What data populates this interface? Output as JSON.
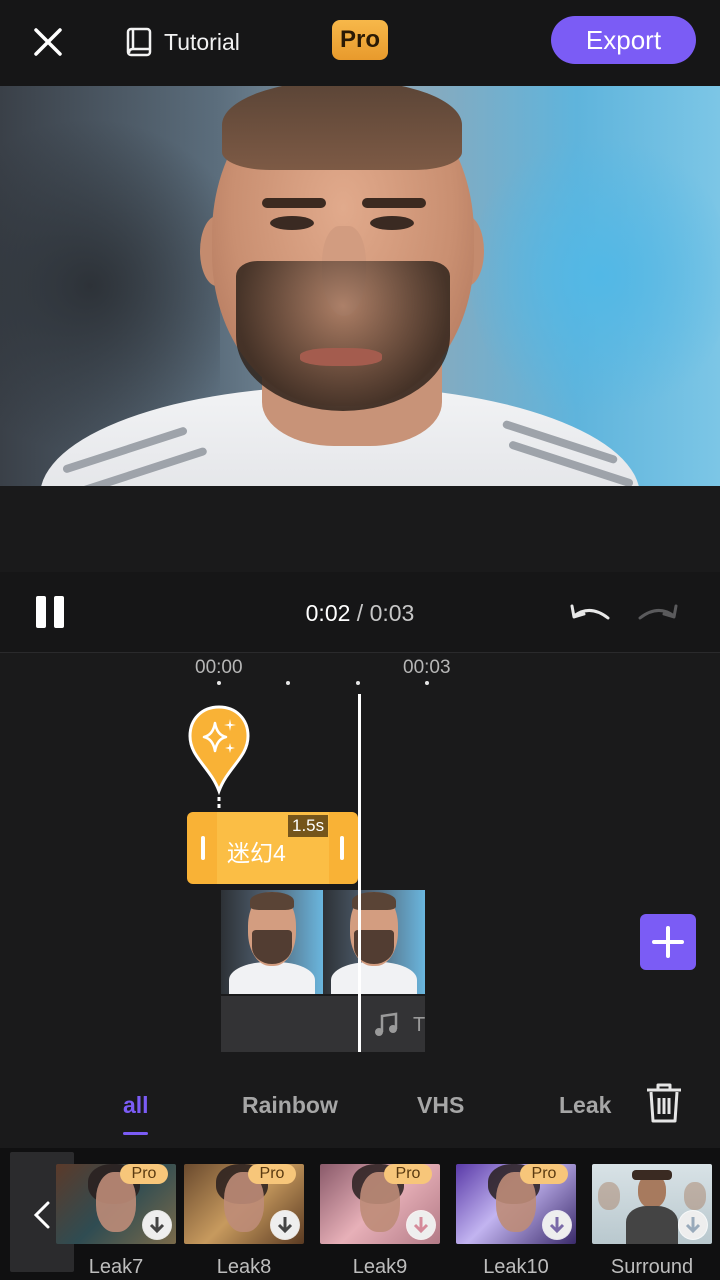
{
  "topbar": {
    "tutorial_label": "Tutorial",
    "pro_badge": "Pro",
    "export_label": "Export",
    "icons": [
      "close-icon",
      "book-icon"
    ]
  },
  "player": {
    "current_time": "0:02",
    "separator": "/",
    "total_time": "0:03"
  },
  "timeline": {
    "ruler": [
      "00:00",
      "00:03"
    ],
    "effect_clip": {
      "name": "迷幻4",
      "duration": "1.5s"
    },
    "audio_track_label": "T"
  },
  "tabs": [
    {
      "label": "all",
      "active": true
    },
    {
      "label": "Rainbow",
      "active": false
    },
    {
      "label": "VHS",
      "active": false
    },
    {
      "label": "Leak",
      "active": false
    }
  ],
  "effects": [
    {
      "label": "Leak7",
      "badge": "Pro"
    },
    {
      "label": "Leak8",
      "badge": "Pro"
    },
    {
      "label": "Leak9",
      "badge": "Pro"
    },
    {
      "label": "Leak10",
      "badge": "Pro"
    },
    {
      "label": "Surround",
      "badge": ""
    }
  ],
  "colors": {
    "accent": "#7b5cf5",
    "effect_clip": "#f9b236",
    "pro_badge": "#f7c67a",
    "background": "#1a1a1b"
  }
}
